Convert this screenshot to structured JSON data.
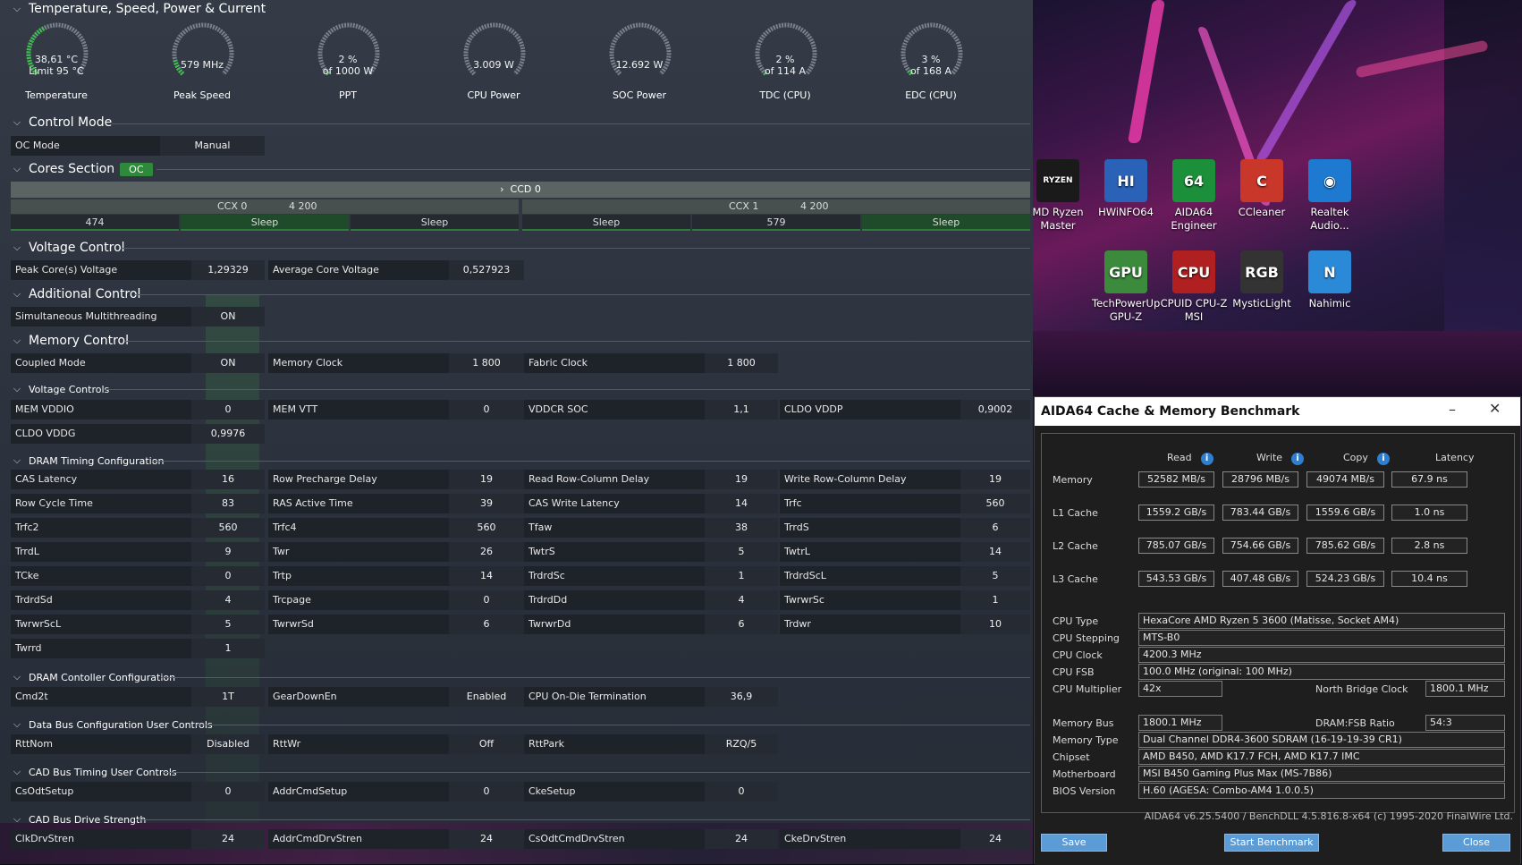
{
  "ryzen_master": {
    "sections": {
      "temp": "Temperature, Speed, Power & Current",
      "control_mode": "Control Mode",
      "cores_section": "Cores Section",
      "oc_badge": "OC",
      "voltage_control": "Voltage Control",
      "additional_control": "Additional Control",
      "memory_control": "Memory Control",
      "voltage_controls": "Voltage Controls",
      "dram_timing": "DRAM Timing Configuration",
      "dram_controller": "DRAM Contoller Configuration",
      "data_bus": "Data Bus Configuration User Controls",
      "cad_timing": "CAD Bus Timing User Controls",
      "cad_drive": "CAD Bus Drive Strength"
    },
    "gauges": [
      {
        "line1": "38,61 °C",
        "line2": "Limit 95 °C",
        "label": "Temperature",
        "level": 0.4
      },
      {
        "line1": "579  MHz",
        "line2": "",
        "label": "Peak Speed",
        "level": 0.12
      },
      {
        "line1": "2 %",
        "line2": "of 1000 W",
        "label": "PPT",
        "level": 0.02
      },
      {
        "line1": "3.009 W",
        "line2": "",
        "label": "CPU Power",
        "level": 0.0
      },
      {
        "line1": "12.692 W",
        "line2": "",
        "label": "SOC Power",
        "level": 0.0
      },
      {
        "line1": "2 %",
        "line2": "of 114 A",
        "label": "TDC (CPU)",
        "level": 0.02
      },
      {
        "line1": "3 %",
        "line2": "of 168 A",
        "label": "EDC (CPU)",
        "level": 0.03
      }
    ],
    "oc_mode": {
      "label": "OC Mode",
      "value": "Manual"
    },
    "ccd": "CCD 0",
    "ccx": [
      {
        "name": "CCX 0",
        "freq": "4 200"
      },
      {
        "name": "CCX 1",
        "freq": "4 200"
      }
    ],
    "cores": [
      "474",
      "Sleep",
      "Sleep",
      "Sleep",
      "579",
      "Sleep"
    ],
    "peak_core_voltage": {
      "label": "Peak Core(s) Voltage",
      "value": "1,29329"
    },
    "avg_core_voltage": {
      "label": "Average Core Voltage",
      "value": "0,527923"
    },
    "smt": {
      "label": "Simultaneous Multithreading",
      "value": "ON"
    },
    "coupled_mode": {
      "label": "Coupled Mode",
      "value": "ON"
    },
    "memory_clock": {
      "label": "Memory Clock",
      "value": "1 800"
    },
    "fabric_clock": {
      "label": "Fabric Clock",
      "value": "1 800"
    },
    "voltages": [
      {
        "label": "MEM VDDIO",
        "value": "0"
      },
      {
        "label": "MEM VTT",
        "value": "0"
      },
      {
        "label": "VDDCR SOC",
        "value": "1,1"
      },
      {
        "label": "CLDO VDDP",
        "value": "0,9002"
      },
      {
        "label": "CLDO VDDG",
        "value": "0,9976"
      }
    ],
    "timings": [
      {
        "label": "CAS Latency",
        "value": "16"
      },
      {
        "label": "Row Precharge Delay",
        "value": "19"
      },
      {
        "label": "Read Row-Column Delay",
        "value": "19"
      },
      {
        "label": "Write Row-Column Delay",
        "value": "19"
      },
      {
        "label": "Row Cycle Time",
        "value": "83"
      },
      {
        "label": "RAS Active Time",
        "value": "39"
      },
      {
        "label": "CAS Write Latency",
        "value": "14"
      },
      {
        "label": "Trfc",
        "value": "560"
      },
      {
        "label": "Trfc2",
        "value": "560"
      },
      {
        "label": "Trfc4",
        "value": "560"
      },
      {
        "label": "Tfaw",
        "value": "38"
      },
      {
        "label": "TrrdS",
        "value": "6"
      },
      {
        "label": "TrrdL",
        "value": "9"
      },
      {
        "label": "Twr",
        "value": "26"
      },
      {
        "label": "TwtrS",
        "value": "5"
      },
      {
        "label": "TwtrL",
        "value": "14"
      },
      {
        "label": "TCke",
        "value": "0"
      },
      {
        "label": "Trtp",
        "value": "14"
      },
      {
        "label": "TrdrdSc",
        "value": "1"
      },
      {
        "label": "TrdrdScL",
        "value": "5"
      },
      {
        "label": "TrdrdSd",
        "value": "4"
      },
      {
        "label": "Trcpage",
        "value": "0"
      },
      {
        "label": "TrdrdDd",
        "value": "4"
      },
      {
        "label": "TwrwrSc",
        "value": "1"
      },
      {
        "label": "TwrwrScL",
        "value": "5"
      },
      {
        "label": "TwrwrSd",
        "value": "6"
      },
      {
        "label": "TwrwrDd",
        "value": "6"
      },
      {
        "label": "Trdwr",
        "value": "10"
      },
      {
        "label": "Twrrd",
        "value": "1"
      }
    ],
    "controller": [
      {
        "label": "Cmd2t",
        "value": "1T"
      },
      {
        "label": "GearDownEn",
        "value": "Enabled"
      },
      {
        "label": "CPU On-Die Termination",
        "value": "36,9"
      }
    ],
    "databus": [
      {
        "label": "RttNom",
        "value": "Disabled"
      },
      {
        "label": "RttWr",
        "value": "Off"
      },
      {
        "label": "RttPark",
        "value": "RZQ/5"
      }
    ],
    "cadtiming": [
      {
        "label": "CsOdtSetup",
        "value": "0"
      },
      {
        "label": "AddrCmdSetup",
        "value": "0"
      },
      {
        "label": "CkeSetup",
        "value": "0"
      }
    ],
    "caddrive": [
      {
        "label": "ClkDrvStren",
        "value": "24"
      },
      {
        "label": "AddrCmdDrvStren",
        "value": "24"
      },
      {
        "label": "CsOdtCmdDrvStren",
        "value": "24"
      },
      {
        "label": "CkeDrvStren",
        "value": "24"
      }
    ]
  },
  "desktop": {
    "icons": [
      {
        "label1": "MD Ryzen",
        "label2": "Master",
        "icon": "ryzen-master-icon",
        "glyph": "RYZEN",
        "color": "#1a1a1a"
      },
      {
        "label1": "HWiNFO64",
        "label2": "",
        "icon": "hwinfo-icon",
        "glyph": "HI",
        "color": "#2a62b8"
      },
      {
        "label1": "AIDA64",
        "label2": "Engineer",
        "icon": "aida64-icon",
        "glyph": "64",
        "color": "#1c8f3a"
      },
      {
        "label1": "CCleaner",
        "label2": "",
        "icon": "ccleaner-icon",
        "glyph": "C",
        "color": "#c8372a"
      },
      {
        "label1": "Realtek",
        "label2": "Audio...",
        "icon": "realtek-icon",
        "glyph": "◉",
        "color": "#1e7ad0"
      },
      {
        "label1": "TechPowerUp",
        "label2": "GPU-Z",
        "icon": "gpuz-icon",
        "glyph": "GPU",
        "color": "#3c8a3c"
      },
      {
        "label1": "CPUID CPU-Z",
        "label2": "MSI",
        "icon": "cpuz-icon",
        "glyph": "CPU",
        "color": "#b02020"
      },
      {
        "label1": "MysticLight",
        "label2": "",
        "icon": "mysticlight-icon",
        "glyph": "RGB",
        "color": "#333"
      },
      {
        "label1": "Nahimic",
        "label2": "",
        "icon": "nahimic-icon",
        "glyph": "N",
        "color": "#2a8ad8"
      }
    ]
  },
  "aida": {
    "title": "AIDA64 Cache & Memory Benchmark",
    "minimize": "–",
    "close_glyph": "✕",
    "headers": {
      "read": "Read",
      "write": "Write",
      "copy": "Copy",
      "latency": "Latency"
    },
    "info_glyph": "i",
    "rows": [
      {
        "label": "Memory",
        "read": "52582 MB/s",
        "write": "28796 MB/s",
        "copy": "49074 MB/s",
        "latency": "67.9 ns"
      },
      {
        "label": "L1 Cache",
        "read": "1559.2 GB/s",
        "write": "783.44 GB/s",
        "copy": "1559.6 GB/s",
        "latency": "1.0 ns"
      },
      {
        "label": "L2 Cache",
        "read": "785.07 GB/s",
        "write": "754.66 GB/s",
        "copy": "785.62 GB/s",
        "latency": "2.8 ns"
      },
      {
        "label": "L3 Cache",
        "read": "543.53 GB/s",
        "write": "407.48 GB/s",
        "copy": "524.23 GB/s",
        "latency": "10.4 ns"
      }
    ],
    "info": {
      "cpu_type": {
        "label": "CPU Type",
        "value": "HexaCore AMD Ryzen 5 3600  (Matisse, Socket AM4)"
      },
      "cpu_stepping": {
        "label": "CPU Stepping",
        "value": "MTS-B0"
      },
      "cpu_clock": {
        "label": "CPU Clock",
        "value": "4200.3 MHz"
      },
      "cpu_fsb": {
        "label": "CPU FSB",
        "value": "100.0 MHz  (original: 100 MHz)"
      },
      "cpu_multiplier": {
        "label": "CPU Multiplier",
        "value": "42x"
      },
      "nb_clock": {
        "label": "North Bridge Clock",
        "value": "1800.1 MHz"
      },
      "memory_bus": {
        "label": "Memory Bus",
        "value": "1800.1 MHz"
      },
      "dram_fsb": {
        "label": "DRAM:FSB Ratio",
        "value": "54:3"
      },
      "memory_type": {
        "label": "Memory Type",
        "value": "Dual Channel DDR4-3600 SDRAM  (16-19-19-39 CR1)"
      },
      "chipset": {
        "label": "Chipset",
        "value": "AMD B450, AMD K17.7 FCH, AMD K17.7 IMC"
      },
      "motherboard": {
        "label": "Motherboard",
        "value": "MSI B450 Gaming Plus Max (MS-7B86)"
      },
      "bios": {
        "label": "BIOS Version",
        "value": "H.60  (AGESA: Combo-AM4 1.0.0.5)"
      }
    },
    "version": "AIDA64 v6.25.5400 / BenchDLL 4.5.816.8-x64  (c) 1995-2020 FinalWire Ltd.",
    "buttons": {
      "save": "Save",
      "start": "Start Benchmark",
      "close": "Close"
    }
  }
}
